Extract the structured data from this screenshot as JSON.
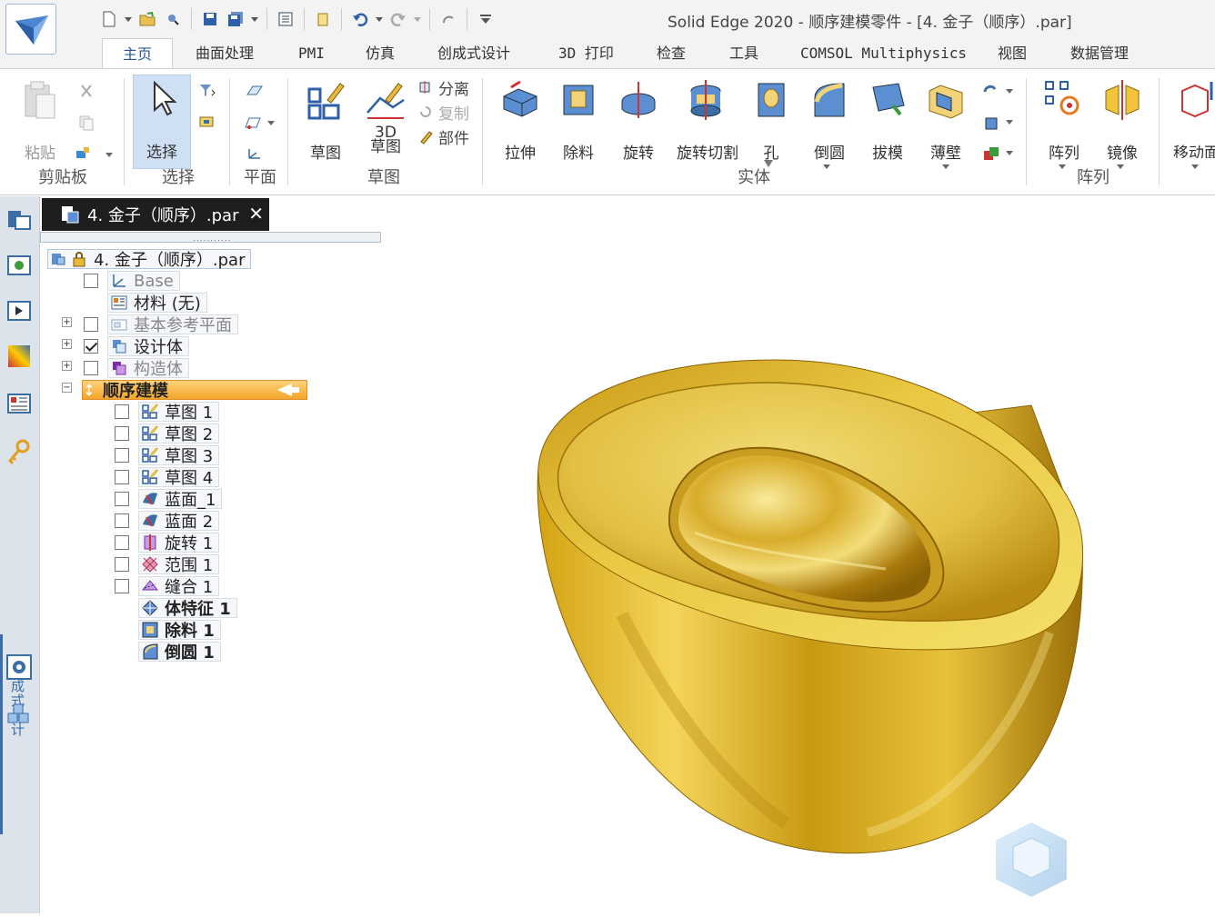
{
  "window": {
    "title": "Solid Edge 2020 - 顺序建模零件 - [4. 金子（顺序）.par]"
  },
  "ribbon_tabs": [
    "主页",
    "曲面处理",
    "PMI",
    "仿真",
    "创成式设计",
    "3D 打印",
    "检查",
    "工具",
    "COMSOL Multiphysics",
    "视图",
    "数据管理"
  ],
  "active_tab": "主页",
  "groups": {
    "clipboard": {
      "label": "剪贴板",
      "paste": "粘贴"
    },
    "select": {
      "label": "选择",
      "select": "选择"
    },
    "plane": {
      "label": "平面"
    },
    "sketch": {
      "label": "草图",
      "sketch": "草图",
      "sketch3d_a": "3D",
      "sketch3d_b": "草图",
      "split": "分离",
      "copy": "复制",
      "part": "部件"
    },
    "solids": {
      "label": "实体",
      "extrude": "拉伸",
      "cut": "除料",
      "revolve": "旋转",
      "revolve_cut": "旋转切割",
      "hole": "孔",
      "round": "倒圆",
      "draft": "拔模",
      "thin_wall": "薄壁"
    },
    "pattern": {
      "label": "阵列",
      "pattern": "阵列",
      "mirror": "镜像"
    },
    "move": {
      "label": "移动面"
    }
  },
  "left_panel": {
    "vertical_label": "创成式设计"
  },
  "document_tab": {
    "label": "4. 金子（顺序）.par",
    "close": "✕"
  },
  "pathfinder": {
    "dots": "...........",
    "root": "4. 金子（顺序）.par",
    "base": "Base",
    "material": "材料 (无)",
    "ref_planes": "基本参考平面",
    "design_body": "设计体",
    "construction": "构造体",
    "sequential": "顺序建模",
    "features": [
      {
        "label": "草图 1",
        "icon": "sketch"
      },
      {
        "label": "草图 2",
        "icon": "sketch"
      },
      {
        "label": "草图 3",
        "icon": "sketch"
      },
      {
        "label": "草图 4",
        "icon": "sketch"
      },
      {
        "label": "蓝面_1",
        "icon": "bluesurf"
      },
      {
        "label": "蓝面 2",
        "icon": "bluesurf"
      },
      {
        "label": "旋转 1",
        "icon": "revolve"
      },
      {
        "label": "范围 1",
        "icon": "bound"
      },
      {
        "label": "缝合 1",
        "icon": "stitch"
      }
    ],
    "body_features": [
      {
        "label": "体特征 1",
        "icon": "body"
      },
      {
        "label": "除料 1",
        "icon": "cutout"
      },
      {
        "label": "倒圆 1",
        "icon": "round"
      }
    ]
  },
  "colors": {
    "gold_light": "#f7e27a",
    "gold_mid": "#d4a314",
    "gold_dark": "#8a6205",
    "accent": "#2b5797"
  }
}
